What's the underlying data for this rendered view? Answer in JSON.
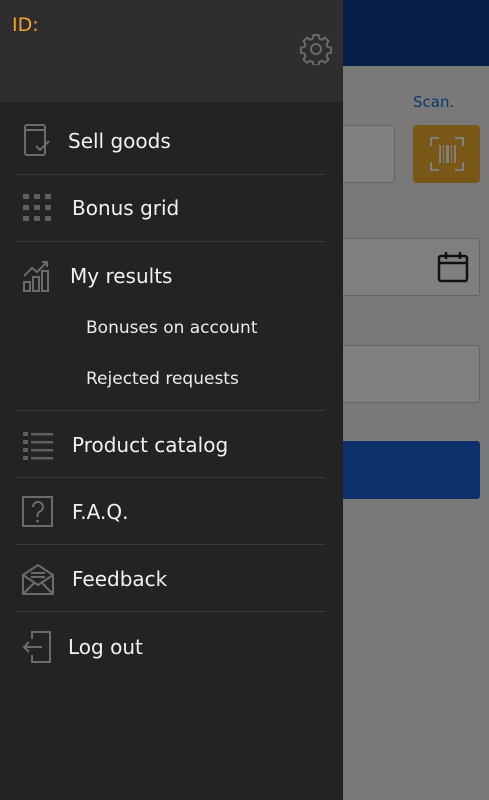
{
  "background": {
    "scan_label": "Scan."
  },
  "drawer": {
    "id_label": "ID:",
    "menu": {
      "sell_goods": "Sell goods",
      "bonus_grid": "Bonus grid",
      "my_results": "My results",
      "bonuses_on_account": "Bonuses on account",
      "rejected_requests": "Rejected requests",
      "product_catalog": "Product catalog",
      "faq": "F.A.Q.",
      "feedback": "Feedback",
      "log_out": "Log out"
    }
  },
  "icons": {
    "settings": "gear-icon",
    "sell_goods": "phone-check-icon",
    "bonus_grid": "grid-icon",
    "my_results": "bar-chart-trend-icon",
    "product_catalog": "list-icon",
    "faq": "question-box-icon",
    "feedback": "envelope-icon",
    "log_out": "logout-icon",
    "scan": "barcode-scan-icon",
    "calendar": "calendar-icon"
  },
  "colors": {
    "id_accent": "#f2a22c",
    "drawer_bg": "#232323",
    "header_blue": "#0f3d8c",
    "scan_button": "#f2b12f",
    "primary_button": "#1e63d6"
  }
}
